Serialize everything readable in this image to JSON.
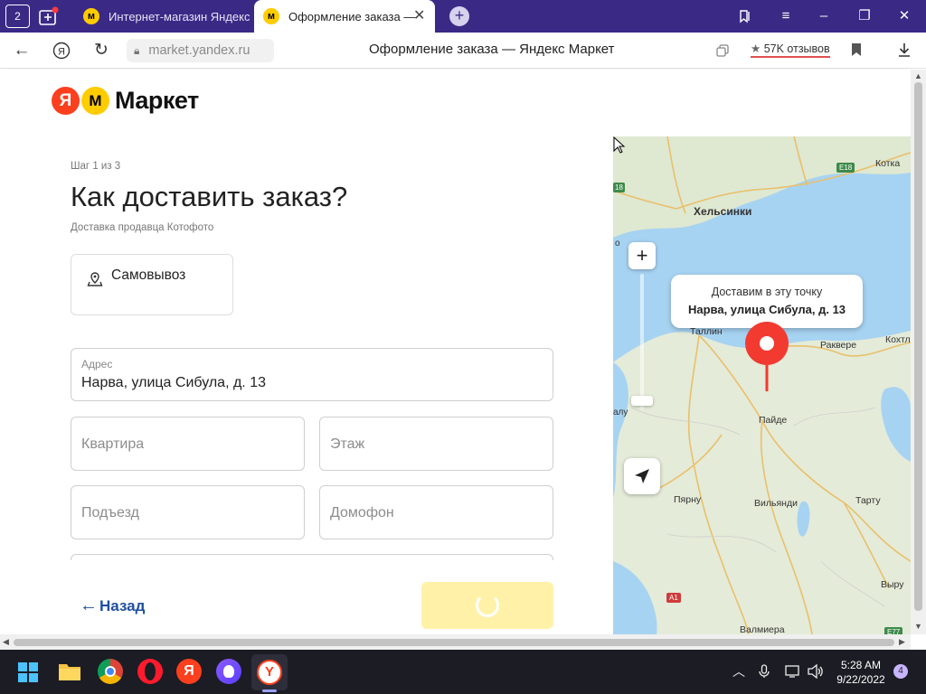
{
  "browser": {
    "tab_count": "2",
    "tabs": [
      {
        "title": "Интернет-магазин Яндекс",
        "active": false
      },
      {
        "title": "Оформление заказа —",
        "active": true
      }
    ],
    "new_tab_label": "+",
    "url": "market.yandex.ru",
    "page_title": "Оформление заказа — Яндекс Маркет",
    "reviews_label": "57K отзывов",
    "reviews_star": "★"
  },
  "market": {
    "logo_ya": "Я",
    "logo_m": "М",
    "logo_word": "Маркет"
  },
  "checkout": {
    "step": "Шаг 1 из 3",
    "title": "Как доставить заказ?",
    "seller": "Доставка продавца Котофото",
    "pickup_label": "Самовывоз",
    "address": {
      "label": "Адрес",
      "value": "Нарва, улица Сибула, д. 13"
    },
    "apartment_placeholder": "Квартира",
    "floor_placeholder": "Этаж",
    "entrance_placeholder": "Подъезд",
    "intercom_placeholder": "Домофон",
    "back_label": "Назад"
  },
  "map": {
    "zoom_in": "+",
    "tooltip_line1": "Доставим в эту точку",
    "tooltip_line2": "Нарва, улица Сибула, д. 13",
    "places": {
      "helsinki": "Хельсинки",
      "kotka": "Котка",
      "tallinn": "Таллин",
      "rakvere": "Раквере",
      "kohtla": "Кохтл",
      "paide": "Пайде",
      "parnu": "Пярну",
      "viljandi": "Вильянди",
      "tartu": "Тарту",
      "voru": "Выру",
      "valmiera": "Валмиера",
      "edge_o": "о",
      "edge_alu": "алу"
    },
    "route_labels": {
      "e18_east": "E18",
      "e18_west": "18",
      "a1": "A1",
      "e77": "E77"
    },
    "colors": {
      "sea": "#a7d3f2",
      "land": "#dfe8d1",
      "pin": "#f23a30"
    }
  },
  "taskbar": {
    "time": "5:28 AM",
    "date": "9/22/2022",
    "notifications": "4"
  }
}
